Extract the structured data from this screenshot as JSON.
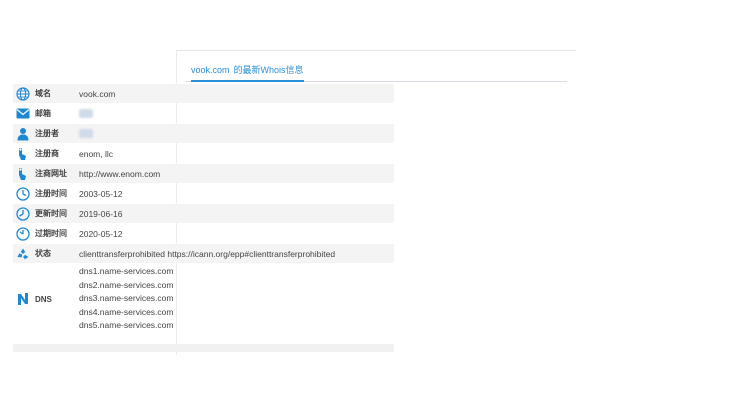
{
  "header": {
    "domain_link": "vook.com",
    "title_suffix": "的最新Whois信息"
  },
  "rows": [
    {
      "label": "域名",
      "value": "vook.com",
      "icon": "globe-icon"
    },
    {
      "label": "邮箱",
      "value": "",
      "icon": "mail-icon"
    },
    {
      "label": "注册者",
      "value": "",
      "icon": "user-icon"
    },
    {
      "label": "注册商",
      "value": "enom, llc",
      "icon": "registrar-icon"
    },
    {
      "label": "注商网址",
      "value": "http://www.enom.com",
      "icon": "registrar-url-icon"
    },
    {
      "label": "注册时间",
      "value": "2003-05-12",
      "icon": "clock-icon"
    },
    {
      "label": "更新时间",
      "value": "2019-06-16",
      "icon": "clock-icon"
    },
    {
      "label": "过期时间",
      "value": "2020-05-12",
      "icon": "clock-icon"
    },
    {
      "label": "状态",
      "value": "clienttransferprohibited https://icann.org/epp#clienttransferprohibited",
      "icon": "recycle-icon"
    }
  ],
  "dns": {
    "label": "DNS",
    "icon": "dns-icon",
    "servers": [
      "dns1.name-services.com",
      "dns2.name-services.com",
      "dns3.name-services.com",
      "dns4.name-services.com",
      "dns5.name-services.com"
    ]
  },
  "colors": {
    "accent": "#2b8fd6",
    "row_shade": "#f4f4f4",
    "icon_blue": "#1e88d2"
  }
}
